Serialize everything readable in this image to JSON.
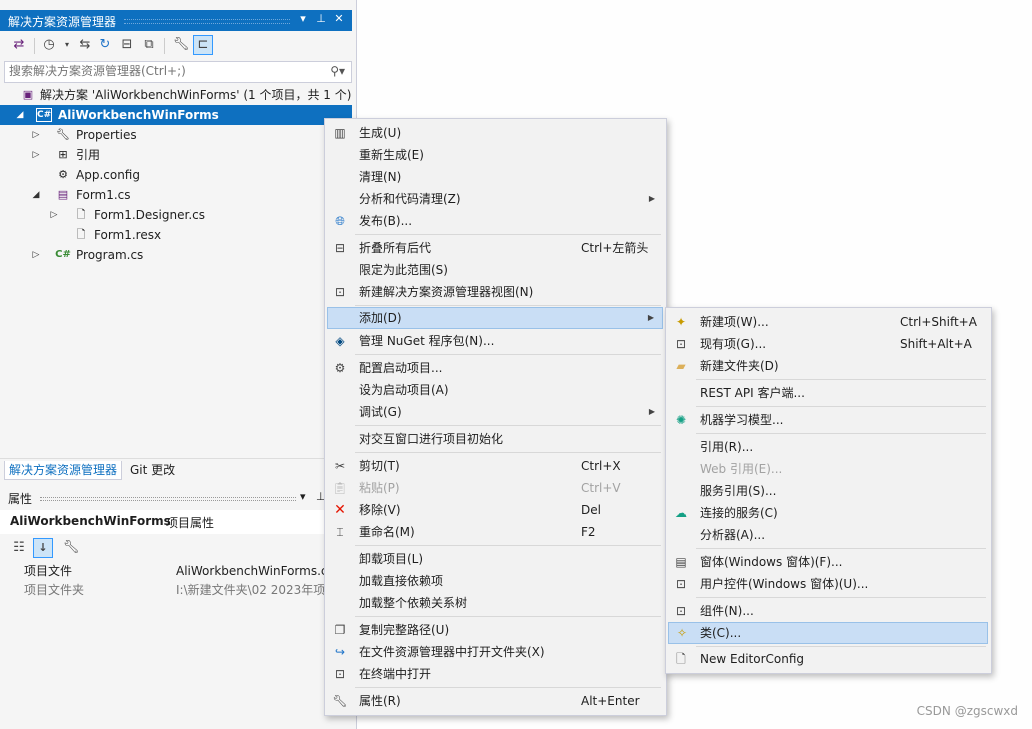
{
  "solution_explorer": {
    "title": "解决方案资源管理器",
    "search_placeholder": "搜索解决方案资源管理器(Ctrl+;)",
    "tree": [
      {
        "label": "解决方案 'AliWorkbenchWinForms' (1 个项目，共 1 个)",
        "icon": "solution-icon"
      },
      {
        "label": "AliWorkbenchWinForms",
        "icon": "csharp-project-icon",
        "selected": true
      },
      {
        "label": "Properties",
        "icon": "wrench-icon"
      },
      {
        "label": "引用",
        "icon": "references-icon"
      },
      {
        "label": "App.config",
        "icon": "config-file-icon"
      },
      {
        "label": "Form1.cs",
        "icon": "form-icon"
      },
      {
        "label": "Form1.Designer.cs",
        "icon": "file-icon"
      },
      {
        "label": "Form1.resx",
        "icon": "file-icon"
      },
      {
        "label": "Program.cs",
        "icon": "csharp-file-icon"
      }
    ],
    "tabs": [
      "解决方案资源管理器",
      "Git 更改"
    ]
  },
  "properties": {
    "title": "属性",
    "object_name": "AliWorkbenchWinForms",
    "object_kind": "项目属性",
    "rows": [
      {
        "key": "项目文件",
        "value": "AliWorkbenchWinForms.c"
      },
      {
        "key": "项目文件夹",
        "value": "I:\\新建文件夹\\02 2023年项"
      }
    ]
  },
  "context_menu": {
    "items": [
      {
        "label": "生成(U)",
        "icon": "build-icon"
      },
      {
        "label": "重新生成(E)"
      },
      {
        "label": "清理(N)"
      },
      {
        "label": "分析和代码清理(Z)",
        "submenu": true
      },
      {
        "label": "发布(B)...",
        "icon": "globe-icon"
      },
      {
        "label": "折叠所有后代",
        "icon": "collapse-icon",
        "shortcut": "Ctrl+左箭头"
      },
      {
        "label": "限定为此范围(S)"
      },
      {
        "label": "新建解决方案资源管理器视图(N)",
        "icon": "new-view-icon"
      },
      {
        "label": "添加(D)",
        "submenu": true,
        "highlighted": true
      },
      {
        "label": "管理 NuGet 程序包(N)...",
        "icon": "nuget-icon"
      },
      {
        "label": "配置启动项目...",
        "icon": "gear-icon"
      },
      {
        "label": "设为启动项目(A)"
      },
      {
        "label": "调试(G)",
        "submenu": true
      },
      {
        "label": "对交互窗口进行项目初始化"
      },
      {
        "label": "剪切(T)",
        "icon": "scissors-icon",
        "shortcut": "Ctrl+X"
      },
      {
        "label": "粘贴(P)",
        "icon": "paste-icon",
        "shortcut": "Ctrl+V",
        "disabled": true
      },
      {
        "label": "移除(V)",
        "icon": "remove-icon",
        "shortcut": "Del"
      },
      {
        "label": "重命名(M)",
        "icon": "rename-icon",
        "shortcut": "F2"
      },
      {
        "label": "卸载项目(L)"
      },
      {
        "label": "加载直接依赖项"
      },
      {
        "label": "加载整个依赖关系树"
      },
      {
        "label": "复制完整路径(U)",
        "icon": "copy-icon"
      },
      {
        "label": "在文件资源管理器中打开文件夹(X)",
        "icon": "open-folder-icon"
      },
      {
        "label": "在终端中打开",
        "icon": "terminal-icon"
      },
      {
        "label": "属性(R)",
        "icon": "wrench-icon",
        "shortcut": "Alt+Enter"
      }
    ]
  },
  "add_submenu": {
    "items": [
      {
        "label": "新建项(W)...",
        "icon": "new-item-icon",
        "shortcut": "Ctrl+Shift+A"
      },
      {
        "label": "现有项(G)...",
        "icon": "existing-item-icon",
        "shortcut": "Shift+Alt+A"
      },
      {
        "label": "新建文件夹(D)",
        "icon": "new-folder-icon"
      },
      {
        "label": "REST API 客户端..."
      },
      {
        "label": "机器学习模型...",
        "icon": "ml-icon"
      },
      {
        "label": "引用(R)..."
      },
      {
        "label": "Web 引用(E)...",
        "disabled": true
      },
      {
        "label": "服务引用(S)..."
      },
      {
        "label": "连接的服务(C)",
        "icon": "connected-service-icon"
      },
      {
        "label": "分析器(A)..."
      },
      {
        "label": "窗体(Windows 窗体)(F)...",
        "icon": "form-icon"
      },
      {
        "label": "用户控件(Windows 窗体)(U)...",
        "icon": "user-control-icon"
      },
      {
        "label": "组件(N)...",
        "icon": "component-icon"
      },
      {
        "label": "类(C)...",
        "icon": "class-icon",
        "highlighted": true
      },
      {
        "label": "New EditorConfig",
        "icon": "file-icon"
      }
    ]
  },
  "watermark": "CSDN @zgscwxd"
}
